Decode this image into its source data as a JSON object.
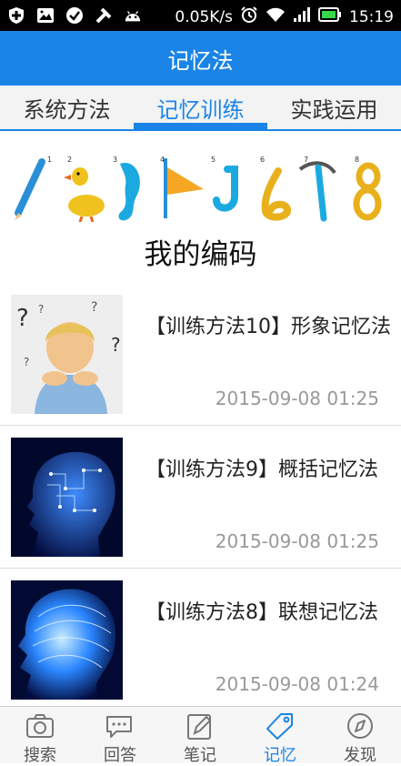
{
  "status_bar": {
    "speed": "0.05K/s",
    "time": "15:19"
  },
  "app_title": "记忆法",
  "tabs": [
    {
      "label": "系统方法"
    },
    {
      "label": "记忆训练"
    },
    {
      "label": "实践运用"
    }
  ],
  "banner": {
    "numbers": [
      "1",
      "2",
      "3",
      "4",
      "5",
      "6",
      "7",
      "8"
    ],
    "title": "我的编码"
  },
  "articles": [
    {
      "title": "【训练方法10】形象记忆法",
      "date": "2015-09-08 01:25"
    },
    {
      "title": "【训练方法9】概括记忆法",
      "date": "2015-09-08 01:25"
    },
    {
      "title": "【训练方法8】联想记忆法",
      "date": "2015-09-08 01:24"
    }
  ],
  "bottom_nav": [
    {
      "label": "搜索",
      "icon": "camera-icon"
    },
    {
      "label": "回答",
      "icon": "chat-icon"
    },
    {
      "label": "笔记",
      "icon": "pencil-icon"
    },
    {
      "label": "记忆",
      "icon": "tag-icon"
    },
    {
      "label": "发现",
      "icon": "compass-icon"
    }
  ]
}
